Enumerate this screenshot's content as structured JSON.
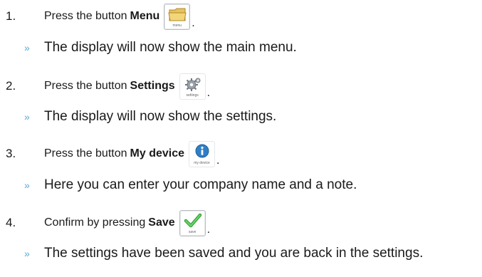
{
  "steps": [
    {
      "number": "1.",
      "lead": "Press the button",
      "bold": "Menu",
      "period": ".",
      "button": {
        "icon": "folder-icon",
        "caption": "menu"
      },
      "result_marker": "»",
      "result": "The display will now show the main menu."
    },
    {
      "number": "2.",
      "lead": "Press the button",
      "bold": "Settings",
      "period": ".",
      "button": {
        "icon": "gears-icon",
        "caption": "settings"
      },
      "result_marker": "»",
      "result": "The display will now show the settings."
    },
    {
      "number": "3.",
      "lead": "Press the button",
      "bold": "My device",
      "period": ".",
      "button": {
        "icon": "info-icon",
        "caption": "my device"
      },
      "result_marker": "»",
      "result": "Here you can enter your company name and a note."
    },
    {
      "number": "4.",
      "lead": "Confirm by pressing",
      "bold": "Save",
      "period": ".",
      "button": {
        "icon": "checkmark-icon",
        "caption": "save"
      },
      "result_marker": "»",
      "result": "The settings have been saved and you are back in the settings."
    }
  ]
}
